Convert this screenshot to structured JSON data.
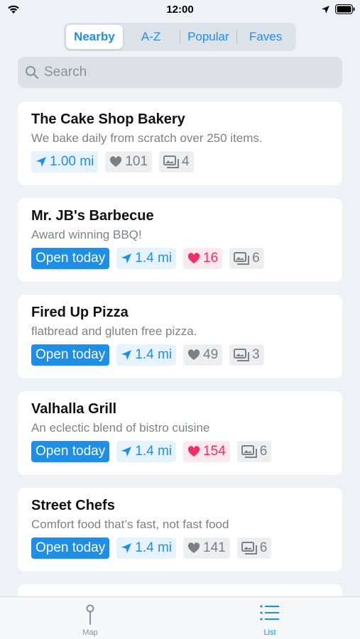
{
  "status_bar": {
    "time": "12:00"
  },
  "segments": [
    "Nearby",
    "A-Z",
    "Popular",
    "Faves"
  ],
  "active_segment": "Nearby",
  "search": {
    "placeholder": "Search",
    "value": ""
  },
  "places": [
    {
      "name": "The Cake Shop Bakery",
      "description": "We bake daily from scratch over 250 items.",
      "open": "",
      "distance": "1.00 mi",
      "likes": "101",
      "liked": false,
      "photos": "4"
    },
    {
      "name": "Mr. JB's Barbecue",
      "description": "Award winning BBQ!",
      "open": "Open today",
      "distance": "1.4 mi",
      "likes": "16",
      "liked": true,
      "photos": "6"
    },
    {
      "name": "Fired Up Pizza",
      "description": "flatbread and gluten free pizza.",
      "open": "Open today",
      "distance": "1.4 mi",
      "likes": "49",
      "liked": false,
      "photos": "3"
    },
    {
      "name": "Valhalla Grill",
      "description": "An eclectic blend of bistro cuisine",
      "open": "Open today",
      "distance": "1.4 mi",
      "likes": "154",
      "liked": true,
      "photos": "6"
    },
    {
      "name": "Street Chefs",
      "description": "Comfort food that’s fast, not fast food",
      "open": "Open today",
      "distance": "1.4 mi",
      "likes": "141",
      "liked": false,
      "photos": "6"
    }
  ],
  "tabbar": {
    "map_label": "Map",
    "list_label": "List",
    "active": "List"
  },
  "colors": {
    "accent": "#1e8fe6",
    "liked": "#ef2f66",
    "background": "#eef1f5"
  }
}
